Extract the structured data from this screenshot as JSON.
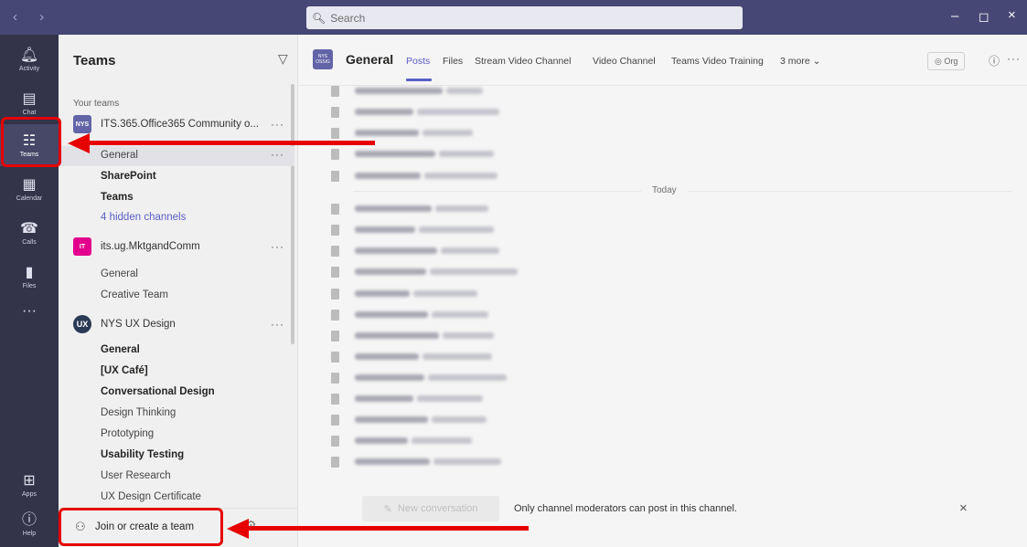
{
  "titlebar": {
    "nav_arrows": "‹ ›",
    "search_placeholder": "Search",
    "controls": {
      "minimize": "–",
      "maximize": "◻",
      "close": "×"
    }
  },
  "rail": [
    {
      "label": "Activity",
      "icon": "bell-icon"
    },
    {
      "label": "Chat",
      "icon": "chat-icon"
    },
    {
      "label": "Teams",
      "icon": "teams-icon",
      "active": true
    },
    {
      "label": "Calendar",
      "icon": "calendar-icon"
    },
    {
      "label": "Calls",
      "icon": "phone-icon"
    },
    {
      "label": "Files",
      "icon": "file-icon"
    },
    {
      "label": "Apps",
      "icon": "apps-icon"
    },
    {
      "label": "Help",
      "icon": "help-icon"
    }
  ],
  "panel": {
    "title": "Teams",
    "your_teams": "Your teams",
    "teams": [
      {
        "name": "ITS.365.Office365 Community o...",
        "channels": [
          "General",
          "SharePoint",
          "Teams",
          "4 hidden channels"
        ]
      },
      {
        "name": "its.ug.MktgandComm",
        "avatar_text": "IT",
        "channels": [
          "General",
          "Creative Team"
        ]
      },
      {
        "name": "NYS UX Design",
        "avatar_text": "UX",
        "channels": [
          "General",
          "[UX Café]",
          "Conversational Design",
          "Design Thinking",
          "Prototyping",
          "Usability Testing",
          "User Research",
          "UX Design Certificate"
        ]
      }
    ],
    "more_label": "···",
    "join_label": "Join or create a team"
  },
  "channel_header": {
    "avatar_text": "NYS OSSIG",
    "title": "General",
    "tabs": [
      "Posts",
      "Files",
      "Stream Video Channel",
      "Video Channel",
      "Teams Video Training",
      "3 more ⌄"
    ],
    "org_label": "◎ Org",
    "info": "ⓘ",
    "more": "···"
  },
  "feed": {
    "today_label": "Today"
  },
  "compose": {
    "button": "New conversation",
    "note": "Only channel moderators can post in this channel.",
    "close": "×"
  },
  "colors": {
    "titlebar": "#464775",
    "rail": "#33344a",
    "accent": "#5b5fc7",
    "annotation": "#e60000"
  }
}
